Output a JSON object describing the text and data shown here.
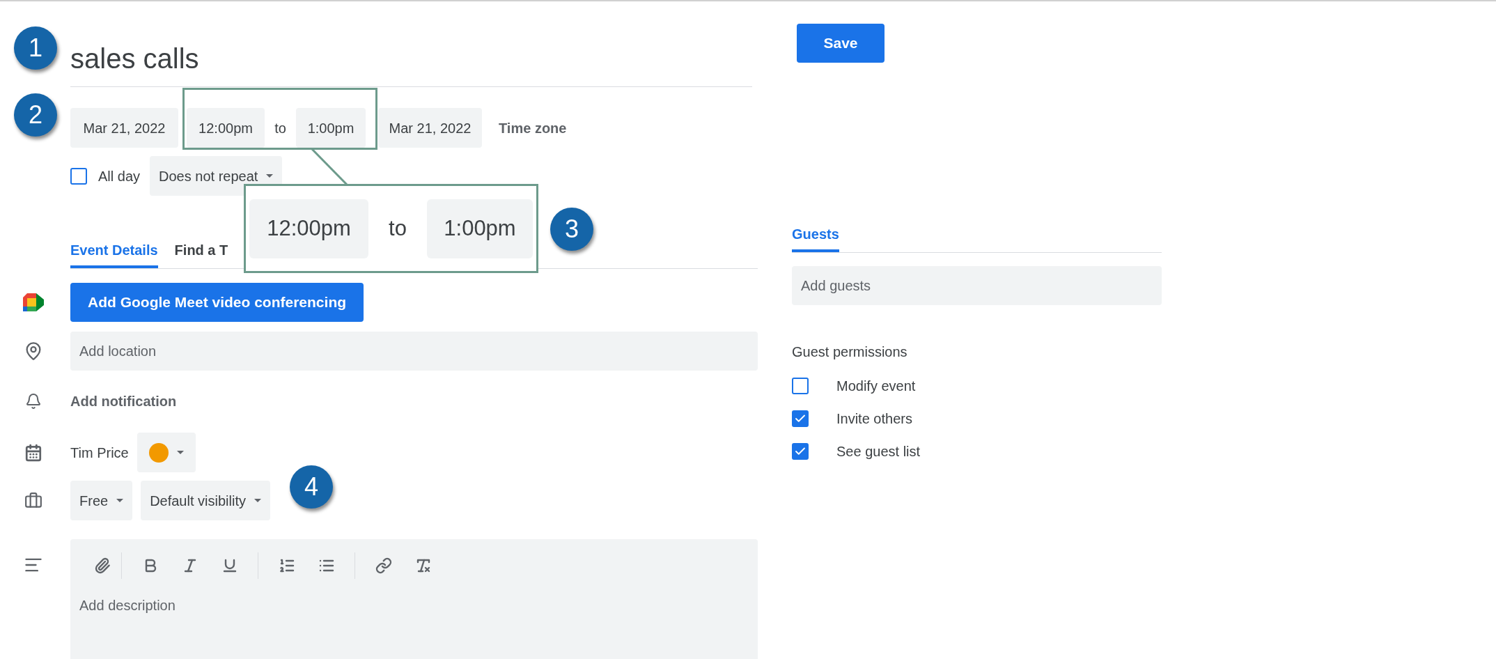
{
  "title": "sales calls",
  "save_button": "Save",
  "date_time": {
    "start_date": "Mar 21, 2022",
    "start_time": "12:00pm",
    "separator": "to",
    "end_time": "1:00pm",
    "end_date": "Mar 21, 2022",
    "time_zone": "Time zone"
  },
  "all_day": {
    "label": "All day",
    "checked": false
  },
  "repeat": "Does not repeat",
  "tabs": [
    {
      "label": "Event Details",
      "selected": true
    },
    {
      "label": "Find a T",
      "selected": false
    }
  ],
  "meet_button": "Add Google Meet video conferencing",
  "location": {
    "placeholder": "Add location"
  },
  "notification": "Add notification",
  "calendar": {
    "name": "Tim Price",
    "color": "#f29900"
  },
  "availability": "Free",
  "visibility": "Default visibility",
  "description": {
    "toolbar": [
      {
        "kind": "attach"
      },
      {
        "kind": "separator"
      },
      {
        "kind": "bold"
      },
      {
        "kind": "italic"
      },
      {
        "kind": "underline"
      },
      {
        "kind": "separator"
      },
      {
        "kind": "numbered-list"
      },
      {
        "kind": "bulleted-list"
      },
      {
        "kind": "separator"
      },
      {
        "kind": "link"
      },
      {
        "kind": "clear-format"
      }
    ],
    "placeholder": "Add description"
  },
  "guests": {
    "tab": {
      "label": "Guests",
      "selected": true
    },
    "placeholder": "Add guests",
    "permissions_title": "Guest permissions",
    "permissions": [
      {
        "label": "Modify event",
        "checked": false
      },
      {
        "label": "Invite others",
        "checked": true
      },
      {
        "label": "See guest list",
        "checked": true
      }
    ]
  },
  "annotations": {
    "badges": [
      "1",
      "2",
      "3",
      "4"
    ],
    "zoom_callout": {
      "start_time": "12:00pm",
      "separator": "to",
      "end_time": "1:00pm"
    }
  }
}
